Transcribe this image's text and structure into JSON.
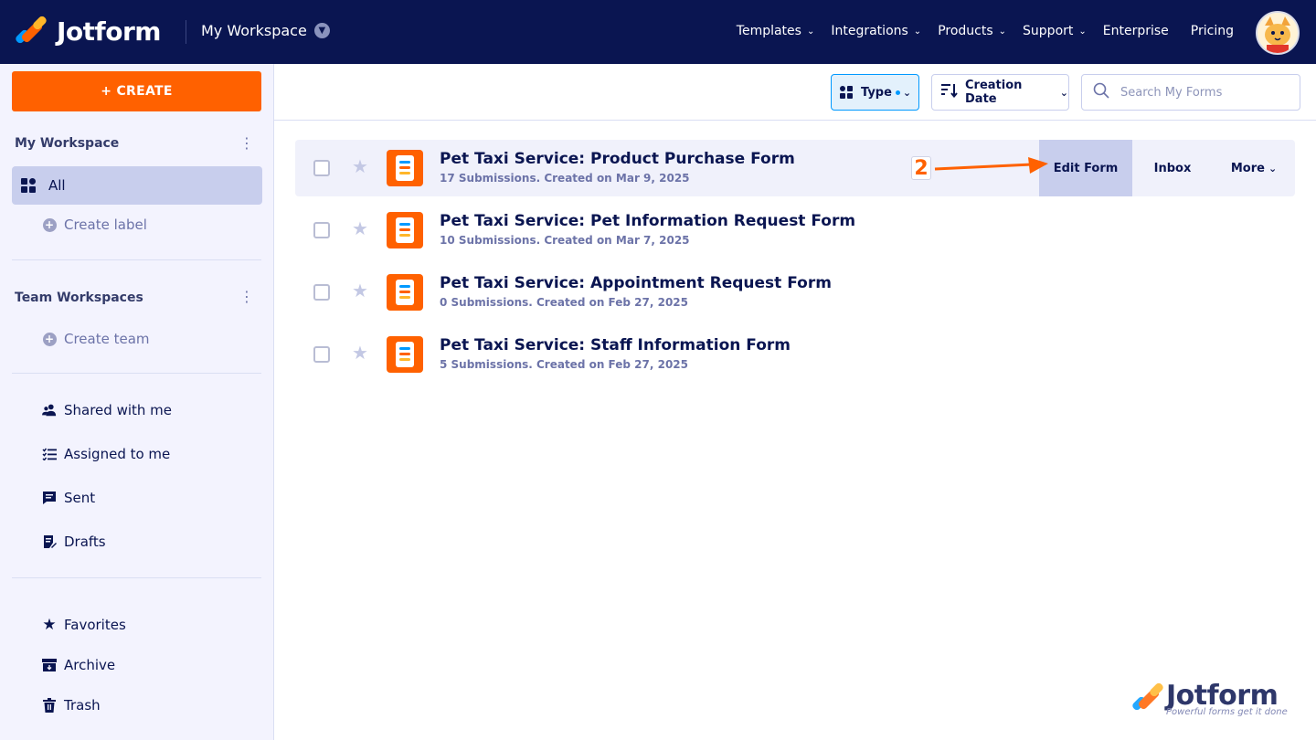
{
  "brand": {
    "name": "Jotform",
    "colors": {
      "navy": "#0a1551",
      "orange": "#ff6100",
      "blue": "#0099ff",
      "yellow": "#ffb629",
      "selected": "#c8ceed"
    }
  },
  "header": {
    "workspace_label": "My Workspace",
    "nav": [
      {
        "label": "Templates",
        "has_caret": true
      },
      {
        "label": "Integrations",
        "has_caret": true
      },
      {
        "label": "Products",
        "has_caret": true
      },
      {
        "label": "Support",
        "has_caret": true
      },
      {
        "label": "Enterprise",
        "has_caret": false
      },
      {
        "label": "Pricing",
        "has_caret": false
      }
    ]
  },
  "sidebar": {
    "create_label": "+ CREATE",
    "my_workspace": {
      "title": "My Workspace",
      "all_label": "All",
      "create_label_text": "Create label"
    },
    "team_workspaces": {
      "title": "Team Workspaces",
      "create_team_text": "Create team"
    },
    "links": [
      {
        "label": "Shared with me",
        "icon": "people-icon"
      },
      {
        "label": "Assigned to me",
        "icon": "checklist-icon"
      },
      {
        "label": "Sent",
        "icon": "message-icon"
      },
      {
        "label": "Drafts",
        "icon": "draft-icon"
      }
    ],
    "bottom_links": [
      {
        "label": "Favorites",
        "icon": "star-icon"
      },
      {
        "label": "Archive",
        "icon": "archive-icon"
      },
      {
        "label": "Trash",
        "icon": "trash-icon"
      }
    ]
  },
  "toolbar": {
    "type_label": "Type",
    "sort_label": "Creation Date",
    "search_placeholder": "Search My Forms"
  },
  "forms": [
    {
      "title": "Pet Taxi Service: Product Purchase Form",
      "meta": "17 Submissions. Created on Mar 9, 2025",
      "hovered": true
    },
    {
      "title": "Pet Taxi Service: Pet Information Request Form",
      "meta": "10 Submissions. Created on Mar 7, 2025",
      "hovered": false
    },
    {
      "title": "Pet Taxi Service: Appointment Request Form",
      "meta": "0 Submissions. Created on Feb 27, 2025",
      "hovered": false
    },
    {
      "title": "Pet Taxi Service: Staff Information Form",
      "meta": "5 Submissions. Created on Feb 27, 2025",
      "hovered": false
    }
  ],
  "row_actions": {
    "edit": "Edit Form",
    "inbox": "Inbox",
    "more": "More"
  },
  "annotation": {
    "step": "2"
  },
  "watermark": {
    "name": "Jotform",
    "tagline": "Powerful forms get it done"
  }
}
